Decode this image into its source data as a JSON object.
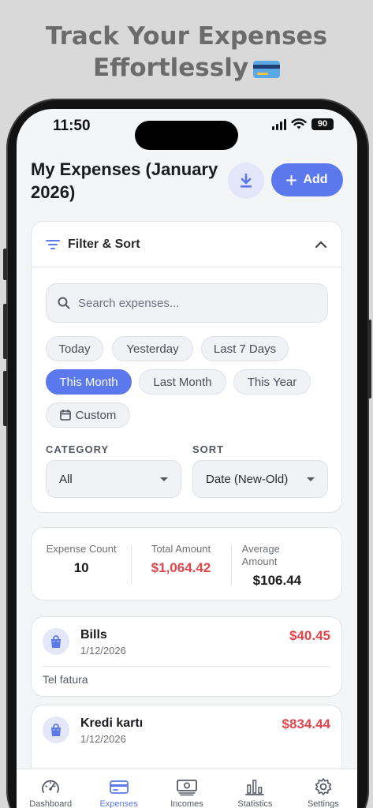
{
  "promo": {
    "line1": "Track Your Expenses",
    "line2": "Effortlessly"
  },
  "status_bar": {
    "time": "11:50",
    "battery": "90"
  },
  "header": {
    "title": "My Expenses (January 2026)",
    "add_label": "Add"
  },
  "filter": {
    "title": "Filter & Sort",
    "search_placeholder": "Search expenses...",
    "chips": [
      "Today",
      "Yesterday",
      "Last 7 Days",
      "This Month",
      "Last Month",
      "This Year",
      "Custom"
    ],
    "active_chip": "This Month",
    "category_label": "CATEGORY",
    "category_value": "All",
    "sort_label": "SORT",
    "sort_value": "Date (New-Old)"
  },
  "stats": {
    "count_label": "Expense Count",
    "count_value": "10",
    "total_label": "Total Amount",
    "total_value": "$1,064.42",
    "avg_label": "Average Amount",
    "avg_value": "$106.44"
  },
  "expenses": [
    {
      "name": "Bills",
      "date": "1/12/2026",
      "amount": "$40.45",
      "note": "Tel fatura"
    },
    {
      "name": "Kredi kartı",
      "date": "1/12/2026",
      "amount": "$834.44",
      "note": ""
    }
  ],
  "tabs": [
    {
      "label": "Dashboard",
      "icon": "gauge-icon"
    },
    {
      "label": "Expenses",
      "icon": "credit-card-icon"
    },
    {
      "label": "Incomes",
      "icon": "cash-icon"
    },
    {
      "label": "Statistics",
      "icon": "bar-chart-icon"
    },
    {
      "label": "Settings",
      "icon": "gear-icon"
    }
  ],
  "active_tab": "Expenses",
  "colors": {
    "accent": "#5b78ec",
    "negative": "#e0474c",
    "background": "#f4f5f7"
  }
}
